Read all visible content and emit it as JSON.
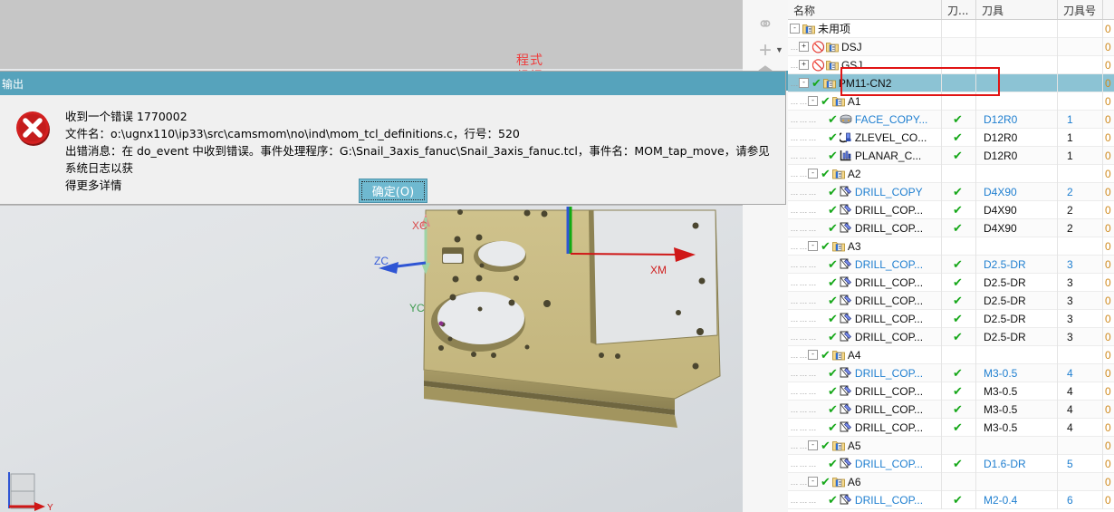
{
  "viewport": {
    "csys": [
      {
        "label": "XC",
        "color": "#d84b4b"
      },
      {
        "label": "ZC",
        "color": "#3a5fd9"
      },
      {
        "label": "YC",
        "color": "#3f9b4f"
      },
      {
        "label": "XM",
        "color": "#d02020"
      }
    ],
    "orient_axis_label": "Y"
  },
  "annotation": {
    "text": "程式\n组报",
    "color": "#ef3b3b"
  },
  "dialog": {
    "title": "输出",
    "icon": "error-x-icon",
    "message": "收到一个错误 1770002\n文件名：o:\\ugnx110\\ip33\\src\\camsmom\\no\\ind\\mom_tcl_definitions.c，行号：520\n出错消息：在 do_event 中收到错误。事件处理程序：G:\\Snail_3axis_fanuc\\Snail_3axis_fanuc.tcl，事件名：MOM_tap_move，请参见系统日志以获\n得更多详情",
    "ok_label": "确定(O)"
  },
  "minibar": {
    "items": [
      {
        "name": "link-icon",
        "glyph": "⚭"
      },
      {
        "name": "plus-icon",
        "glyph": "+"
      },
      {
        "name": "chevron-down-icon",
        "glyph": "▼"
      },
      {
        "name": "plane-icon",
        "glyph": "⬟"
      }
    ]
  },
  "tree": {
    "columns": [
      {
        "key": "name",
        "label": "名称"
      },
      {
        "key": "gen",
        "label": "刀..."
      },
      {
        "key": "tool",
        "label": "刀具"
      },
      {
        "key": "toolnum",
        "label": "刀具号"
      },
      {
        "key": "more",
        "label": ""
      }
    ],
    "rows": [
      {
        "depth": 0,
        "expander": "-",
        "status": "none",
        "icon": "program-group-icon",
        "name": "未用项",
        "gen": "",
        "tool": "",
        "toolnum": "",
        "more": "0",
        "blue": false,
        "selected": false
      },
      {
        "depth": 1,
        "expander": "+",
        "status": "banned",
        "icon": "program-group-icon",
        "name": "DSJ",
        "gen": "",
        "tool": "",
        "toolnum": "",
        "more": "0",
        "blue": false,
        "selected": false
      },
      {
        "depth": 1,
        "expander": "+",
        "status": "banned",
        "icon": "program-group-icon",
        "name": "GSJ",
        "gen": "",
        "tool": "",
        "toolnum": "",
        "more": "0",
        "blue": false,
        "selected": false
      },
      {
        "depth": 1,
        "expander": "-",
        "status": "check",
        "icon": "program-group-icon",
        "name": "PM11-CN2",
        "gen": "",
        "tool": "",
        "toolnum": "",
        "more": "0",
        "blue": false,
        "selected": true
      },
      {
        "depth": 2,
        "expander": "-",
        "status": "check",
        "icon": "program-group-icon",
        "name": "A1",
        "gen": "",
        "tool": "",
        "toolnum": "",
        "more": "0",
        "blue": false,
        "selected": false
      },
      {
        "depth": 3,
        "expander": "",
        "status": "check",
        "icon": "face-mill-icon",
        "name": "FACE_COPY...",
        "gen": "check",
        "tool": "D12R0",
        "toolnum": "1",
        "more": "0",
        "blue": true,
        "selected": false
      },
      {
        "depth": 3,
        "expander": "",
        "status": "check",
        "icon": "zlevel-icon",
        "name": "ZLEVEL_CO...",
        "gen": "check",
        "tool": "D12R0",
        "toolnum": "1",
        "more": "0",
        "blue": false,
        "selected": false
      },
      {
        "depth": 3,
        "expander": "",
        "status": "check",
        "icon": "planar-icon",
        "name": "PLANAR_C...",
        "gen": "check",
        "tool": "D12R0",
        "toolnum": "1",
        "more": "0",
        "blue": false,
        "selected": false
      },
      {
        "depth": 2,
        "expander": "-",
        "status": "check",
        "icon": "program-group-icon",
        "name": "A2",
        "gen": "",
        "tool": "",
        "toolnum": "",
        "more": "0",
        "blue": false,
        "selected": false
      },
      {
        "depth": 3,
        "expander": "",
        "status": "check",
        "icon": "drill-icon",
        "name": "DRILL_COPY",
        "gen": "check",
        "tool": "D4X90",
        "toolnum": "2",
        "more": "0",
        "blue": true,
        "selected": false
      },
      {
        "depth": 3,
        "expander": "",
        "status": "check",
        "icon": "drill-icon",
        "name": "DRILL_COP...",
        "gen": "check",
        "tool": "D4X90",
        "toolnum": "2",
        "more": "0",
        "blue": false,
        "selected": false
      },
      {
        "depth": 3,
        "expander": "",
        "status": "check",
        "icon": "drill-icon",
        "name": "DRILL_COP...",
        "gen": "check",
        "tool": "D4X90",
        "toolnum": "2",
        "more": "0",
        "blue": false,
        "selected": false
      },
      {
        "depth": 2,
        "expander": "-",
        "status": "check",
        "icon": "program-group-icon",
        "name": "A3",
        "gen": "",
        "tool": "",
        "toolnum": "",
        "more": "0",
        "blue": false,
        "selected": false
      },
      {
        "depth": 3,
        "expander": "",
        "status": "check",
        "icon": "drill-icon",
        "name": "DRILL_COP...",
        "gen": "check",
        "tool": "D2.5-DR",
        "toolnum": "3",
        "more": "0",
        "blue": true,
        "selected": false
      },
      {
        "depth": 3,
        "expander": "",
        "status": "check",
        "icon": "drill-icon",
        "name": "DRILL_COP...",
        "gen": "check",
        "tool": "D2.5-DR",
        "toolnum": "3",
        "more": "0",
        "blue": false,
        "selected": false
      },
      {
        "depth": 3,
        "expander": "",
        "status": "check",
        "icon": "drill-icon",
        "name": "DRILL_COP...",
        "gen": "check",
        "tool": "D2.5-DR",
        "toolnum": "3",
        "more": "0",
        "blue": false,
        "selected": false
      },
      {
        "depth": 3,
        "expander": "",
        "status": "check",
        "icon": "drill-icon",
        "name": "DRILL_COP...",
        "gen": "check",
        "tool": "D2.5-DR",
        "toolnum": "3",
        "more": "0",
        "blue": false,
        "selected": false
      },
      {
        "depth": 3,
        "expander": "",
        "status": "check",
        "icon": "drill-icon",
        "name": "DRILL_COP...",
        "gen": "check",
        "tool": "D2.5-DR",
        "toolnum": "3",
        "more": "0",
        "blue": false,
        "selected": false
      },
      {
        "depth": 2,
        "expander": "-",
        "status": "check",
        "icon": "program-group-icon",
        "name": "A4",
        "gen": "",
        "tool": "",
        "toolnum": "",
        "more": "0",
        "blue": false,
        "selected": false
      },
      {
        "depth": 3,
        "expander": "",
        "status": "check",
        "icon": "drill-icon",
        "name": "DRILL_COP...",
        "gen": "check",
        "tool": "M3-0.5",
        "toolnum": "4",
        "more": "0",
        "blue": true,
        "selected": false
      },
      {
        "depth": 3,
        "expander": "",
        "status": "check",
        "icon": "drill-icon",
        "name": "DRILL_COP...",
        "gen": "check",
        "tool": "M3-0.5",
        "toolnum": "4",
        "more": "0",
        "blue": false,
        "selected": false
      },
      {
        "depth": 3,
        "expander": "",
        "status": "check",
        "icon": "drill-icon",
        "name": "DRILL_COP...",
        "gen": "check",
        "tool": "M3-0.5",
        "toolnum": "4",
        "more": "0",
        "blue": false,
        "selected": false
      },
      {
        "depth": 3,
        "expander": "",
        "status": "check",
        "icon": "drill-icon",
        "name": "DRILL_COP...",
        "gen": "check",
        "tool": "M3-0.5",
        "toolnum": "4",
        "more": "0",
        "blue": false,
        "selected": false
      },
      {
        "depth": 2,
        "expander": "-",
        "status": "check",
        "icon": "program-group-icon",
        "name": "A5",
        "gen": "",
        "tool": "",
        "toolnum": "",
        "more": "0",
        "blue": false,
        "selected": false
      },
      {
        "depth": 3,
        "expander": "",
        "status": "check",
        "icon": "drill-icon",
        "name": "DRILL_COP...",
        "gen": "check",
        "tool": "D1.6-DR",
        "toolnum": "5",
        "more": "0",
        "blue": true,
        "selected": false
      },
      {
        "depth": 2,
        "expander": "-",
        "status": "check",
        "icon": "program-group-icon",
        "name": "A6",
        "gen": "",
        "tool": "",
        "toolnum": "",
        "more": "0",
        "blue": false,
        "selected": false
      },
      {
        "depth": 3,
        "expander": "",
        "status": "check",
        "icon": "drill-icon",
        "name": "DRILL_COP...",
        "gen": "check",
        "tool": "M2-0.4",
        "toolnum": "6",
        "more": "0",
        "blue": true,
        "selected": false
      }
    ]
  },
  "colors": {
    "title_bar": "#56a3bc",
    "selection": "#8cc3d4",
    "annotation_red": "#ef3b3b",
    "link_blue": "#1f7fd0",
    "check_green": "#17a81a"
  }
}
